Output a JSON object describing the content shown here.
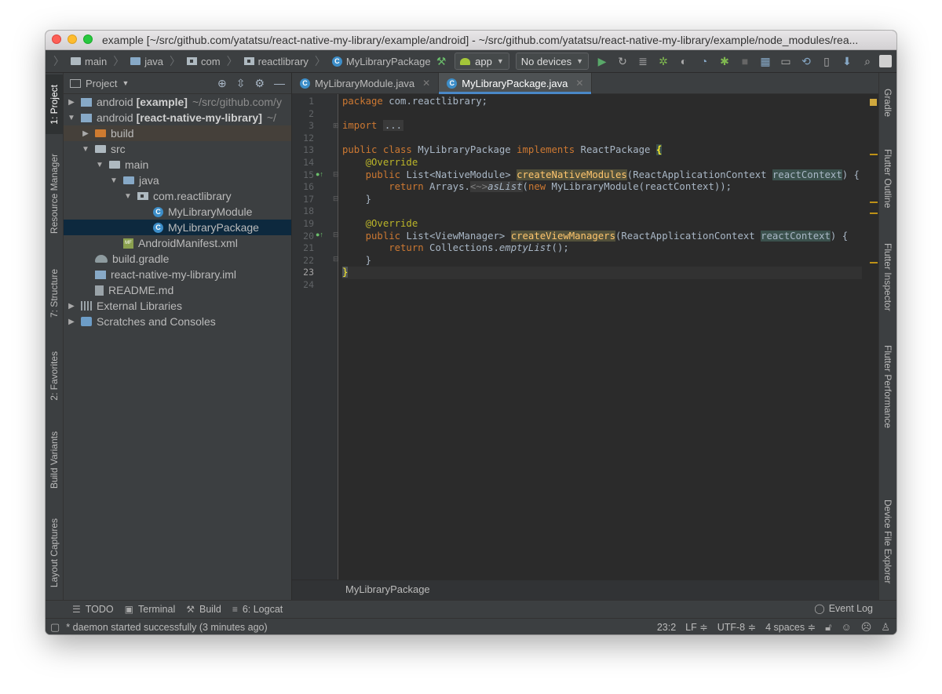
{
  "window": {
    "title": "example [~/src/github.com/yatatsu/react-native-my-library/example/android] - ~/src/github.com/yatatsu/react-native-my-library/example/node_modules/rea..."
  },
  "navbar": {
    "crumbs": [
      "main",
      "java",
      "com",
      "reactlibrary",
      "MyLibraryPackage"
    ],
    "run_config": "app",
    "device": "No devices"
  },
  "left_stripe": {
    "tabs": [
      "1: Project",
      "Resource Manager",
      "7: Structure",
      "2: Favorites",
      "Build Variants",
      "Layout Captures"
    ]
  },
  "right_stripe": {
    "tabs": [
      "Gradle",
      "Flutter Outline",
      "Flutter Inspector",
      "Flutter Performance",
      "Device File Explorer"
    ]
  },
  "project_panel": {
    "title": "Project",
    "tree": [
      {
        "label": "android",
        "bold": "[example]",
        "dim": "~/src/github.com/y"
      },
      {
        "label": "android",
        "bold": "[react-native-my-library]",
        "dim": "~/"
      },
      {
        "label": "build"
      },
      {
        "label": "src"
      },
      {
        "label": "main"
      },
      {
        "label": "java"
      },
      {
        "label": "com.reactlibrary"
      },
      {
        "label": "MyLibraryModule"
      },
      {
        "label": "MyLibraryPackage"
      },
      {
        "label": "AndroidManifest.xml"
      },
      {
        "label": "build.gradle"
      },
      {
        "label": "react-native-my-library.iml"
      },
      {
        "label": "README.md"
      },
      {
        "label": "External Libraries"
      },
      {
        "label": "Scratches and Consoles"
      }
    ]
  },
  "editor": {
    "tabs": [
      {
        "label": "MyLibraryModule.java",
        "active": false
      },
      {
        "label": "MyLibraryPackage.java",
        "active": true
      }
    ],
    "line_numbers": [
      "1",
      "2",
      "3",
      "12",
      "13",
      "14",
      "15",
      "16",
      "17",
      "18",
      "19",
      "20",
      "21",
      "22",
      "23",
      "24"
    ],
    "code": {
      "l1_kw": "package",
      "l1_rest": " com.reactlibrary;",
      "l3_kw": "import",
      "l3_fold": "...",
      "l13_a": "public class",
      "l13_b": " MyLibraryPackage ",
      "l13_c": "implements",
      "l13_d": " ReactPackage ",
      "l13_e": "{",
      "l14": "    @Override",
      "l15_a": "    public",
      "l15_b": " List<NativeModule> ",
      "l15_fn": "createNativeModules",
      "l15_c": "(ReactApplicationContext ",
      "l15_p": "reactContext",
      "l15_d": ") {",
      "l16_a": "        return",
      "l16_b": " Arrays.",
      "l16_gen": "<~>",
      "l16_fn": "asList",
      "l16_c": "(",
      "l16_new": "new",
      "l16_d": " MyLibraryModule(reactContext));",
      "l17": "    }",
      "l19": "    @Override",
      "l20_a": "    public",
      "l20_b": " List<ViewManager> ",
      "l20_fn": "createViewManagers",
      "l20_c": "(ReactApplicationContext ",
      "l20_p": "reactContext",
      "l20_d": ") {",
      "l21_a": "        return",
      "l21_b": " Collections.",
      "l21_fn": "emptyList",
      "l21_c": "();",
      "l22": "    }",
      "l23": "}"
    },
    "breadcrumb": "MyLibraryPackage"
  },
  "bottom_tabs": {
    "todo": "TODO",
    "terminal": "Terminal",
    "build": "Build",
    "logcat": "6: Logcat",
    "event_log": "Event Log"
  },
  "status": {
    "message": "* daemon started successfully (3 minutes ago)",
    "position": "23:2",
    "line_sep": "LF ≑",
    "encoding": "UTF-8 ≑",
    "indent": "4 spaces ≑"
  }
}
